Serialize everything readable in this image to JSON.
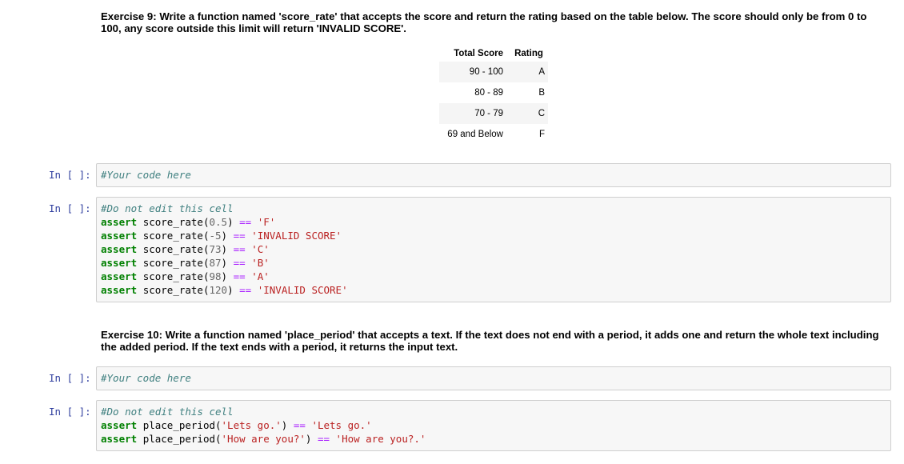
{
  "exercise9": {
    "text": "Exercise 9: Write a function named 'score_rate' that accepts the score and return the rating based on the table below. The score should only be from 0 to 100, any score outside this limit will return 'INVALID SCORE'.",
    "table": {
      "headers": [
        "Total Score",
        "Rating"
      ],
      "rows": [
        [
          "90 - 100",
          "A"
        ],
        [
          "80 - 89",
          "B"
        ],
        [
          "70 - 79",
          "C"
        ],
        [
          "69 and Below",
          "F"
        ]
      ]
    },
    "code_cell": {
      "prompt": "In [ ]:",
      "comment": "#Your code here"
    },
    "test_cell": {
      "prompt": "In [ ]:",
      "comment": "#Do not edit this cell",
      "lines": [
        {
          "func": "score_rate",
          "arg": "0.5",
          "expected": "'F'"
        },
        {
          "func": "score_rate",
          "arg": "-5",
          "expected": "'INVALID SCORE'"
        },
        {
          "func": "score_rate",
          "arg": "73",
          "expected": "'C'"
        },
        {
          "func": "score_rate",
          "arg": "87",
          "expected": "'B'"
        },
        {
          "func": "score_rate",
          "arg": "98",
          "expected": "'A'"
        },
        {
          "func": "score_rate",
          "arg": "120",
          "expected": "'INVALID SCORE'"
        }
      ]
    }
  },
  "exercise10": {
    "text": "Exercise 10: Write a function named 'place_period' that accepts a text. If the text does not end with a period, it adds one and return the whole text including the added period. If the text ends with a period, it returns the input text.",
    "code_cell": {
      "prompt": "In [ ]:",
      "comment": "#Your code here"
    },
    "test_cell": {
      "prompt": "In [ ]:",
      "comment": "#Do not edit this cell",
      "lines": [
        {
          "func": "place_period",
          "arg": "'Lets go.'",
          "expected": "'Lets go.'"
        },
        {
          "func": "place_period",
          "arg": "'How are you?'",
          "expected": "'How are you?.'"
        }
      ]
    }
  },
  "syntax": {
    "keyword": "assert",
    "operator": "=="
  }
}
